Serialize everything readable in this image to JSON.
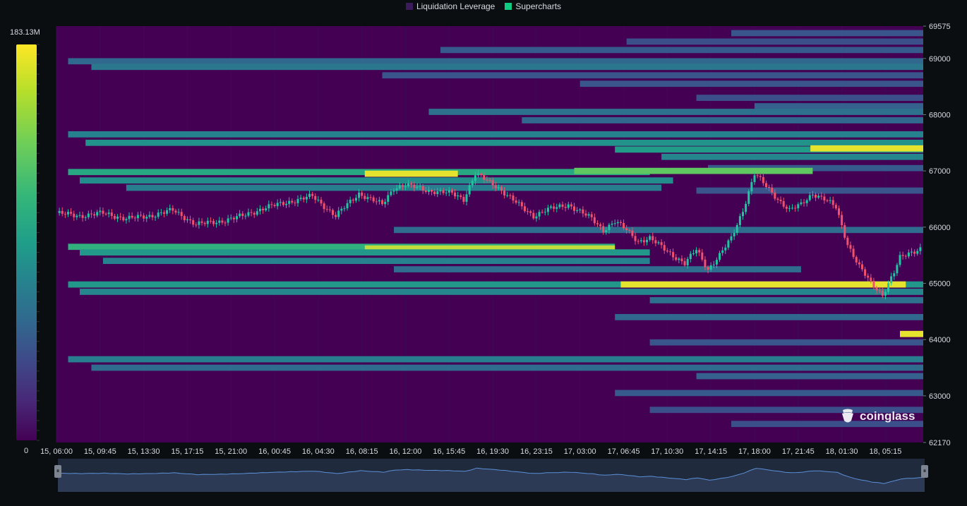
{
  "legend": {
    "items": [
      {
        "label": "Liquidation Leverage",
        "color": "#3b1b5c"
      },
      {
        "label": "Supercharts",
        "color": "#0ecb81"
      }
    ]
  },
  "colorbar": {
    "max_label": "183.13M",
    "min_label": "0"
  },
  "watermark": {
    "text": "coinglass"
  },
  "chart_data": {
    "type": "heatmap",
    "overlay": "candlestick",
    "legend_placement": "top-center",
    "y_axis": {
      "side": "right",
      "ylim": [
        62170,
        69575
      ],
      "ticks": [
        "69575",
        "69000",
        "68000",
        "67000",
        "66000",
        "65000",
        "64000",
        "63000",
        "62170"
      ]
    },
    "x_axis": {
      "ticks": [
        "15, 06:00",
        "15, 09:45",
        "15, 13:30",
        "15, 17:15",
        "15, 21:00",
        "16, 00:45",
        "16, 04:30",
        "16, 08:15",
        "16, 12:00",
        "16, 15:45",
        "16, 19:30",
        "16, 23:15",
        "17, 03:00",
        "17, 06:45",
        "17, 10:30",
        "17, 14:15",
        "17, 18:00",
        "17, 21:45",
        "18, 01:30",
        "18, 05:15"
      ]
    },
    "time_range_hours": [
      0,
      74.5
    ],
    "colorscale": "viridis",
    "value_range": [
      0,
      183130000
    ],
    "liquidation_bands": [
      {
        "price": 69450,
        "start_h": 58,
        "end_h": 74.5,
        "intensity": 0.3
      },
      {
        "price": 69300,
        "start_h": 49,
        "end_h": 74.5,
        "intensity": 0.28
      },
      {
        "price": 69150,
        "start_h": 33,
        "end_h": 74.5,
        "intensity": 0.32
      },
      {
        "price": 68950,
        "start_h": 1,
        "end_h": 74.5,
        "intensity": 0.38
      },
      {
        "price": 68850,
        "start_h": 3,
        "end_h": 74.5,
        "intensity": 0.45
      },
      {
        "price": 68700,
        "start_h": 28,
        "end_h": 74.5,
        "intensity": 0.3
      },
      {
        "price": 68550,
        "start_h": 45,
        "end_h": 74.5,
        "intensity": 0.3
      },
      {
        "price": 68300,
        "start_h": 55,
        "end_h": 74.5,
        "intensity": 0.28
      },
      {
        "price": 68150,
        "start_h": 60,
        "end_h": 74.5,
        "intensity": 0.35
      },
      {
        "price": 68050,
        "start_h": 32,
        "end_h": 74.5,
        "intensity": 0.42
      },
      {
        "price": 67900,
        "start_h": 40,
        "end_h": 74.5,
        "intensity": 0.38
      },
      {
        "price": 67650,
        "start_h": 1,
        "end_h": 74.5,
        "intensity": 0.5
      },
      {
        "price": 67500,
        "start_h": 2.5,
        "end_h": 74.5,
        "intensity": 0.58
      },
      {
        "price": 67380,
        "start_h": 48,
        "end_h": 74.5,
        "intensity": 0.62
      },
      {
        "price": 67400,
        "start_h": 64.8,
        "end_h": 74.5,
        "intensity": 0.98
      },
      {
        "price": 67250,
        "start_h": 52,
        "end_h": 74.5,
        "intensity": 0.52
      },
      {
        "price": 67050,
        "start_h": 56,
        "end_h": 74.5,
        "intensity": 0.32
      },
      {
        "price": 66980,
        "start_h": 1,
        "end_h": 51,
        "intensity": 0.68
      },
      {
        "price": 66950,
        "start_h": 26.5,
        "end_h": 34.5,
        "intensity": 0.98
      },
      {
        "price": 67000,
        "start_h": 44.5,
        "end_h": 65,
        "intensity": 0.85
      },
      {
        "price": 66830,
        "start_h": 2,
        "end_h": 53,
        "intensity": 0.55
      },
      {
        "price": 66700,
        "start_h": 6,
        "end_h": 52,
        "intensity": 0.48
      },
      {
        "price": 66650,
        "start_h": 55,
        "end_h": 74.5,
        "intensity": 0.3
      },
      {
        "price": 65950,
        "start_h": 29,
        "end_h": 74.5,
        "intensity": 0.4
      },
      {
        "price": 65650,
        "start_h": 1,
        "end_h": 48,
        "intensity": 0.72
      },
      {
        "price": 65620,
        "start_h": 26.5,
        "end_h": 48,
        "intensity": 0.95
      },
      {
        "price": 65550,
        "start_h": 2,
        "end_h": 51,
        "intensity": 0.6
      },
      {
        "price": 65400,
        "start_h": 4,
        "end_h": 51,
        "intensity": 0.5
      },
      {
        "price": 65250,
        "start_h": 29,
        "end_h": 64,
        "intensity": 0.4
      },
      {
        "price": 64980,
        "start_h": 1,
        "end_h": 74.5,
        "intensity": 0.6
      },
      {
        "price": 64980,
        "start_h": 48.5,
        "end_h": 73,
        "intensity": 0.98
      },
      {
        "price": 64850,
        "start_h": 2,
        "end_h": 74.5,
        "intensity": 0.52
      },
      {
        "price": 64700,
        "start_h": 51,
        "end_h": 74.5,
        "intensity": 0.42
      },
      {
        "price": 64400,
        "start_h": 48,
        "end_h": 74.5,
        "intensity": 0.38
      },
      {
        "price": 64100,
        "start_h": 72.5,
        "end_h": 74.5,
        "intensity": 0.98
      },
      {
        "price": 63950,
        "start_h": 51,
        "end_h": 74.5,
        "intensity": 0.3
      },
      {
        "price": 63650,
        "start_h": 1,
        "end_h": 74.5,
        "intensity": 0.48
      },
      {
        "price": 63500,
        "start_h": 3,
        "end_h": 74.5,
        "intensity": 0.4
      },
      {
        "price": 63350,
        "start_h": 55,
        "end_h": 74.5,
        "intensity": 0.35
      },
      {
        "price": 63050,
        "start_h": 48,
        "end_h": 74.5,
        "intensity": 0.32
      },
      {
        "price": 62750,
        "start_h": 51,
        "end_h": 74.5,
        "intensity": 0.28
      },
      {
        "price": 62500,
        "start_h": 58,
        "end_h": 74.5,
        "intensity": 0.28
      }
    ],
    "price_series": {
      "hours": [
        0,
        2,
        4,
        6,
        8,
        10,
        12,
        14,
        16,
        18,
        20,
        22,
        24,
        26,
        28,
        29,
        30,
        32,
        34,
        35,
        36,
        38,
        40,
        41,
        42,
        44,
        46,
        47,
        48,
        49,
        50,
        51,
        52,
        53,
        54,
        55,
        56,
        57,
        58,
        59,
        60,
        62,
        63,
        64,
        65,
        66,
        67,
        68,
        69,
        70,
        71,
        72,
        72.5,
        73,
        74,
        74.5
      ],
      "close": [
        66250,
        66200,
        66250,
        66150,
        66200,
        66300,
        66050,
        66100,
        66200,
        66350,
        66450,
        66550,
        66200,
        66600,
        66400,
        66700,
        66750,
        66650,
        66600,
        66500,
        66950,
        66700,
        66350,
        66200,
        66300,
        66400,
        66150,
        65950,
        66100,
        65950,
        65750,
        65800,
        65650,
        65500,
        65350,
        65600,
        65250,
        65500,
        65800,
        66300,
        66950,
        66500,
        66300,
        66400,
        66600,
        66500,
        66350,
        65700,
        65300,
        65000,
        64800,
        65200,
        65450,
        65500,
        65600,
        65650
      ]
    }
  }
}
